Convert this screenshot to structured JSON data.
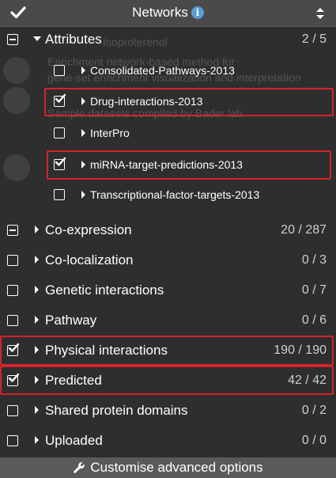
{
  "header": {
    "title": "Networks",
    "info_icon": "i"
  },
  "background_text": [
    "Isoproterenol",
    "Enrichment network-based method for",
    "gene-set enrichment visualization and interpretation",
    "Sample datasets compiled by Bader lab"
  ],
  "attributes": {
    "label": "Attributes",
    "count": "2 / 5",
    "items": [
      {
        "label": "Consolidated-Pathways-2013",
        "checked": false
      },
      {
        "label": "Drug-interactions-2013",
        "checked": true
      },
      {
        "label": "InterPro",
        "checked": false
      },
      {
        "label": "miRNA-target-predictions-2013",
        "checked": true
      },
      {
        "label": "Transcriptional-factor-targets-2013",
        "checked": false
      }
    ]
  },
  "groups": [
    {
      "label": "Co-expression",
      "count": "20 / 287",
      "state": "partial"
    },
    {
      "label": "Co-localization",
      "count": "0 / 3",
      "state": "unchecked"
    },
    {
      "label": "Genetic interactions",
      "count": "0 / 7",
      "state": "unchecked"
    },
    {
      "label": "Pathway",
      "count": "0 / 6",
      "state": "unchecked"
    },
    {
      "label": "Physical interactions",
      "count": "190 / 190",
      "state": "checked"
    },
    {
      "label": "Predicted",
      "count": "42 / 42",
      "state": "checked"
    },
    {
      "label": "Shared protein domains",
      "count": "0 / 2",
      "state": "unchecked"
    },
    {
      "label": "Uploaded",
      "count": "0 / 0",
      "state": "unchecked"
    }
  ],
  "footer": {
    "label": "Customise advanced options",
    "icon": "wrench-icon"
  },
  "colors": {
    "panel_bg": "#2e2e2e",
    "header_bg": "#4a4a4a",
    "highlight": "#d3242b",
    "info_badge": "#5b9bd5"
  }
}
